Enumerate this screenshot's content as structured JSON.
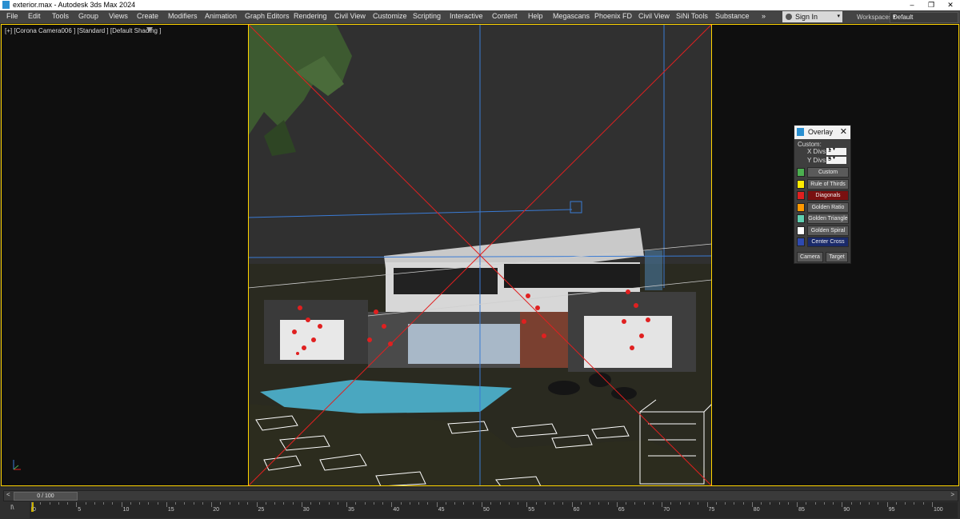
{
  "window": {
    "title": "exterior.max - Autodesk 3ds Max 2024",
    "min_glyph": "–",
    "restore_glyph": "❐",
    "close_glyph": "✕"
  },
  "menu": [
    "File",
    "Edit",
    "Tools",
    "Group",
    "Views",
    "Create",
    "Modifiers",
    "Animation",
    "Graph Editors",
    "Rendering",
    "Civil View",
    "Customize",
    "Scripting",
    "Interactive",
    "Content",
    "Help",
    "Megascans",
    "Phoenix FD",
    "Civil View",
    "SiNi Tools",
    "Substance"
  ],
  "menu_more": "»",
  "signin": {
    "label": "Sign In",
    "dropdown": "▾"
  },
  "workspaces": {
    "label": "Workspaces:",
    "value": "Default",
    "arrow": "▾"
  },
  "viewport": {
    "label": "[+] [Corona Camera006 ] [Standard ] [Default Shading ]"
  },
  "overlay": {
    "title": "Overlay",
    "close": "✕",
    "custom_label": "Custom:",
    "x_divs_label": "X Divs:",
    "x_divs_value": "1",
    "y_divs_label": "Y Divs:",
    "y_divs_value": "5",
    "spin_arrows": "▲▼",
    "items": [
      {
        "label": "Custom",
        "color": "#4caf50",
        "active": false
      },
      {
        "label": "Rule of Thirds",
        "color": "#ffeb00",
        "active": false
      },
      {
        "label": "Diagonals",
        "color": "#e02020",
        "active": true
      },
      {
        "label": "Golden Ratio",
        "color": "#ff9900",
        "active": false
      },
      {
        "label": "Golden Triangle",
        "color": "#5fcfb0",
        "active": false
      },
      {
        "label": "Golden Spiral",
        "color": "#ffffff",
        "active": false
      },
      {
        "label": "Center Cross",
        "color": "#2e4ab0",
        "active": false
      }
    ],
    "camera_label": "Camera",
    "target_label": "Target"
  },
  "timeline": {
    "frame_display": "0 / 100",
    "prev": "<",
    "next": ">",
    "ticks": [
      "0",
      "5",
      "10",
      "15",
      "20",
      "25",
      "30",
      "35",
      "40",
      "45",
      "50",
      "55",
      "60",
      "65",
      "70",
      "75",
      "80",
      "85",
      "90",
      "95",
      "100"
    ],
    "key_icon": "I\\"
  },
  "colors": {
    "viewport_border": "#ffd400",
    "diagonal": "#e02020",
    "guide": "#3a7bd5"
  }
}
